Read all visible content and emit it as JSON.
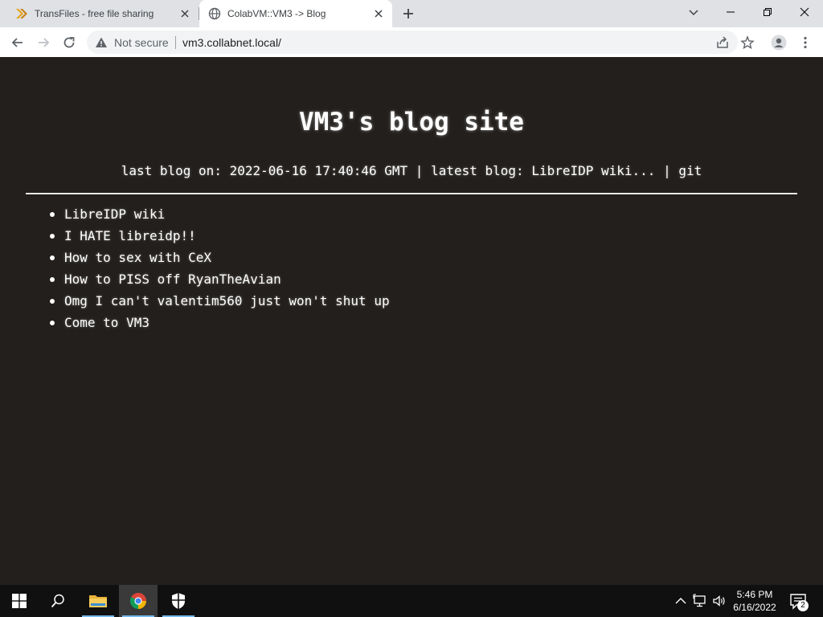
{
  "browser": {
    "tabs": [
      {
        "title": "TransFiles - free file sharing service",
        "active": false,
        "icon": "transfiles-chevron-icon"
      },
      {
        "title": "ColabVM::VM3 -> Blog",
        "active": true,
        "icon": "globe-icon"
      }
    ],
    "security_label": "Not secure",
    "url": "vm3.collabnet.local/"
  },
  "page": {
    "heading": "VM3's blog site",
    "meta": {
      "last_blog_prefix": "last blog on:",
      "last_blog_date": "2022-06-16 17:40:46 GMT",
      "separator": "|",
      "latest_prefix": "latest blog:",
      "latest_link": "LibreIDP wiki...",
      "git_link": "git"
    },
    "posts": [
      "LibreIDP wiki",
      "I HATE libreidp!!",
      "How to sex with CeX",
      "How to PISS off RyanTheAvian",
      "Omg I can't valentim560 just won't shut up",
      "Come to VM3"
    ]
  },
  "taskbar": {
    "time": "5:46 PM",
    "date": "6/16/2022",
    "notification_count": "2"
  },
  "colors": {
    "page_bg": "#221f1c",
    "tabstrip_bg": "#dfe1e5",
    "taskbar_bg": "#101010",
    "accent": "#76b9ed"
  }
}
